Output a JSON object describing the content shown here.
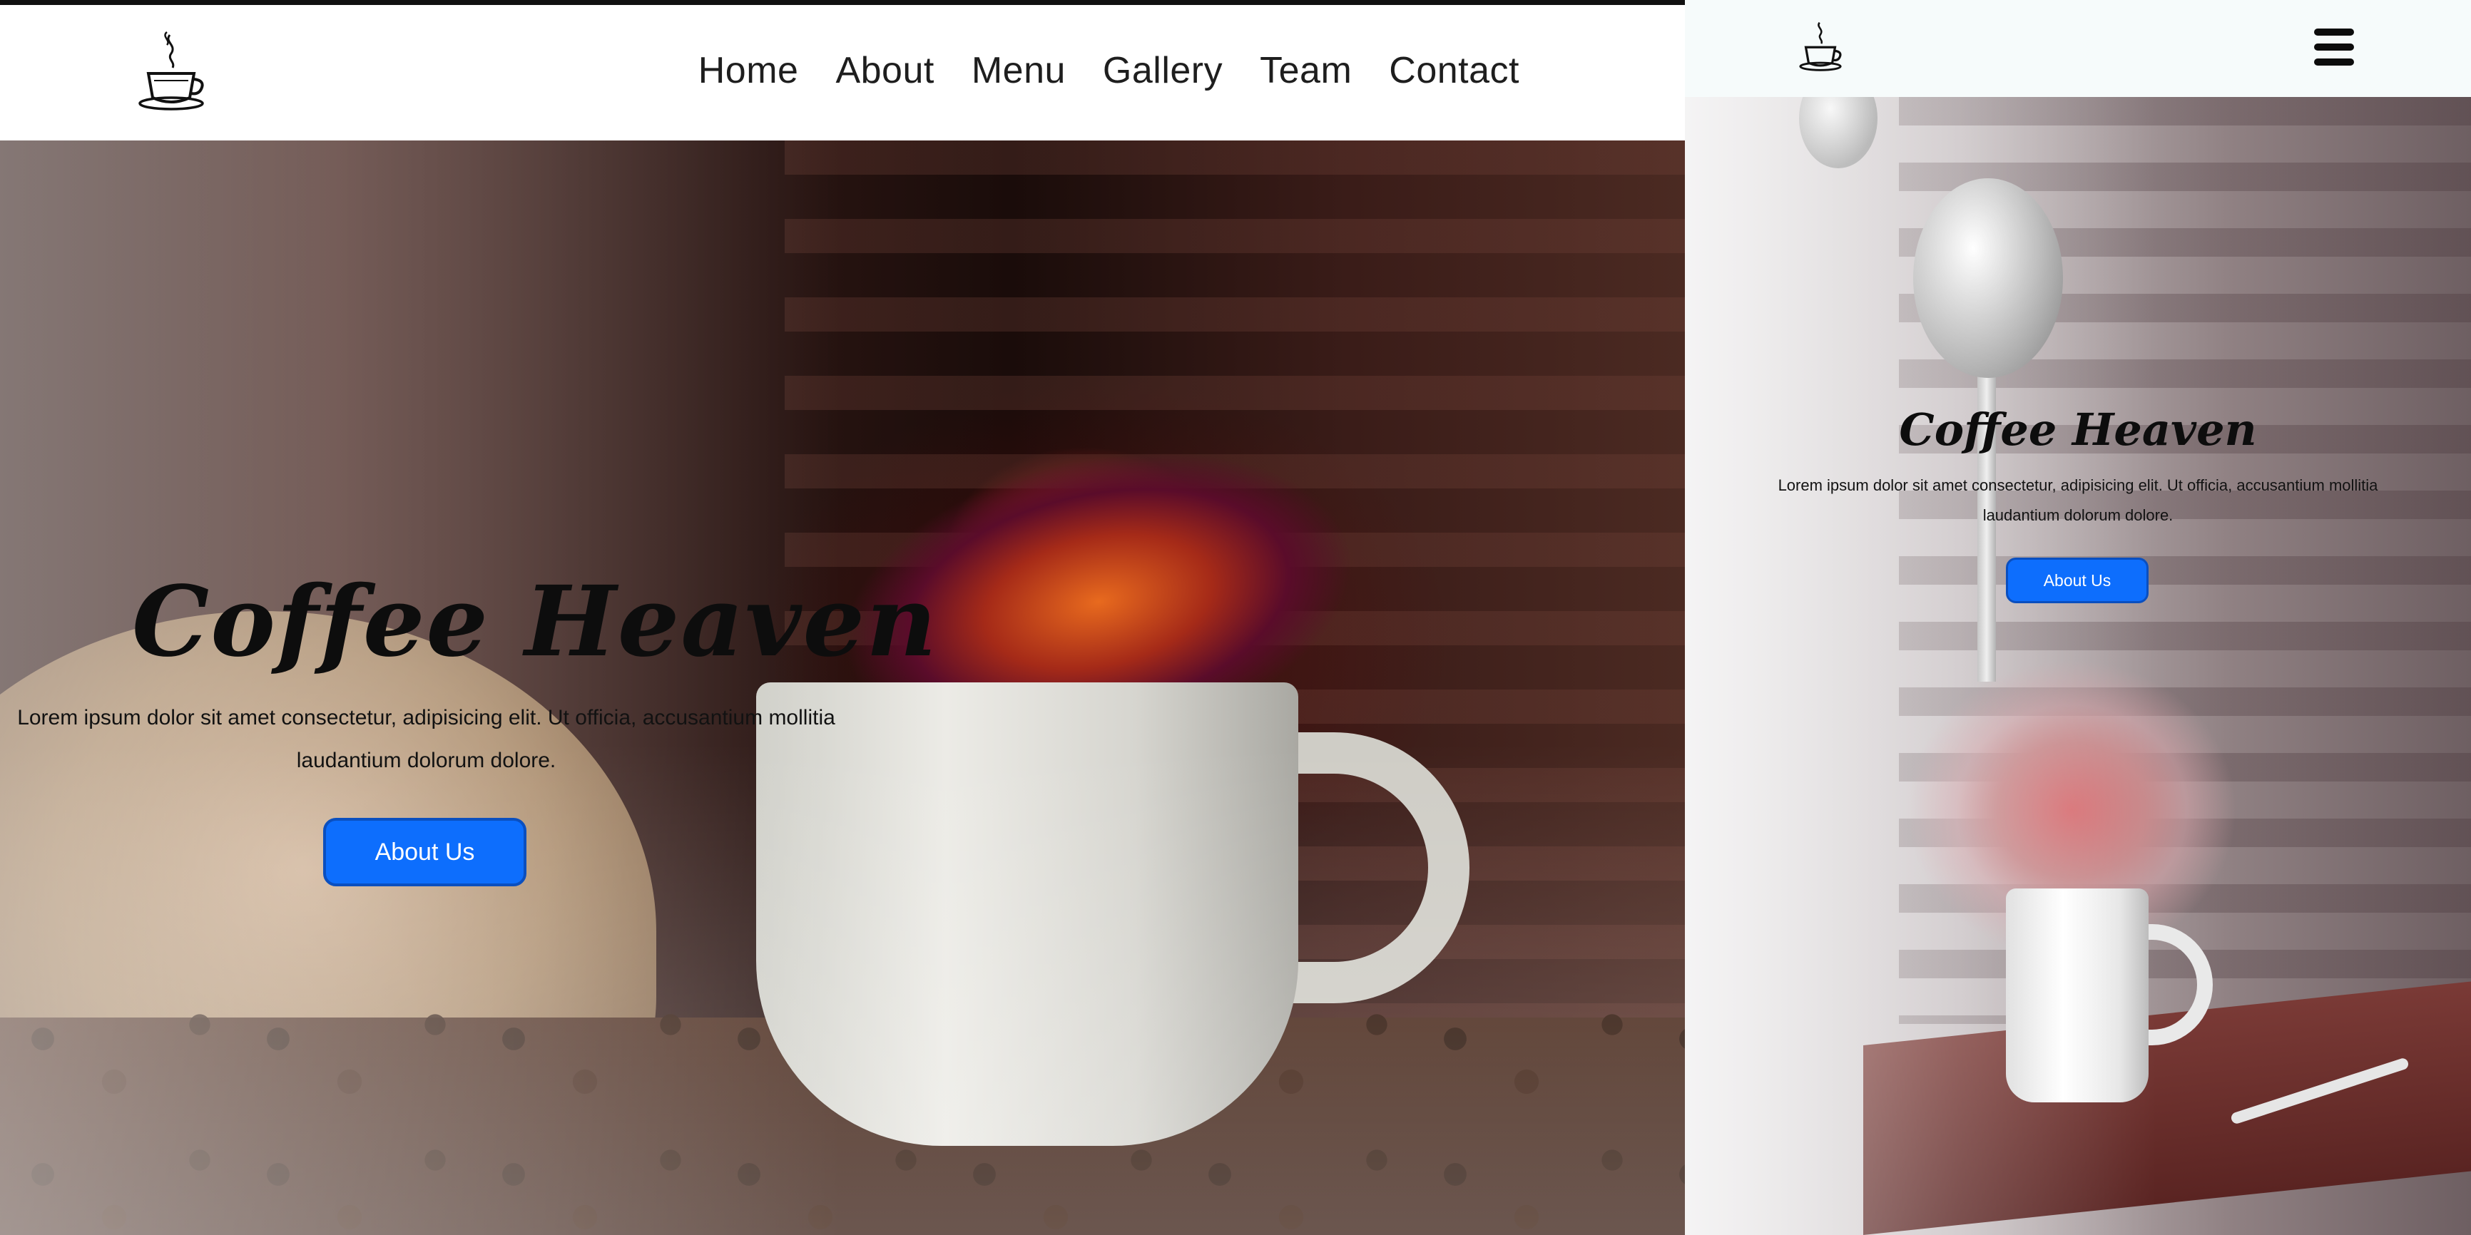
{
  "brand": {
    "logo_icon": "coffee-cup-icon"
  },
  "desktop": {
    "nav": {
      "items": [
        {
          "label": "Home"
        },
        {
          "label": "About"
        },
        {
          "label": "Menu"
        },
        {
          "label": "Gallery"
        },
        {
          "label": "Team"
        },
        {
          "label": "Contact"
        }
      ]
    },
    "hero": {
      "title": "Coffee Heaven",
      "lead": "Lorem ipsum dolor sit amet consectetur, adipisicing elit. Ut officia, accusantium mollitia laudantium dolorum dolore.",
      "button_label": "About Us"
    }
  },
  "mobile": {
    "menu_icon": "hamburger-menu-icon",
    "hero": {
      "title": "Coffee Heaven",
      "lead": "Lorem ipsum dolor sit amet consectetur, adipisicing elit. Ut officia, accusantium mollitia laudantium dolorum dolore.",
      "button_label": "About Us"
    }
  },
  "colors": {
    "button": "#0d6efd",
    "button_border": "#0a4fbf",
    "nav_bg": "#ffffff",
    "mobile_nav_bg": "#f6fbfb",
    "title": "#0d0d0d"
  }
}
